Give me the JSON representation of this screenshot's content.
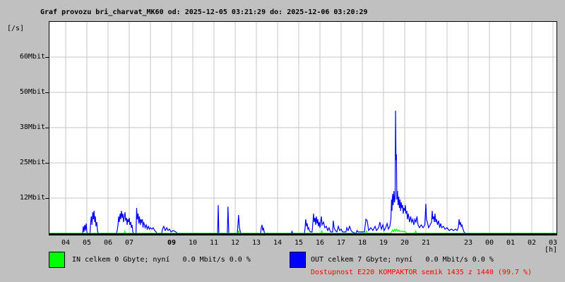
{
  "page": {
    "background": "#c0c0c0",
    "plot_background": "#ffffff",
    "grid_color": "#c6c6c6"
  },
  "title": "Graf provozu bri_charvat_MK60 od: 2025-12-05 03:21:29 do: 2025-12-06 03:20:29",
  "axes": {
    "y_unit": "[/s]",
    "x_unit": "[h]",
    "y_ticks": [
      {
        "label": "60Mbit",
        "value": 62.5
      },
      {
        "label": "50Mbit",
        "value": 50
      },
      {
        "label": "38Mbit",
        "value": 37.5
      },
      {
        "label": "25Mbit",
        "value": 25
      },
      {
        "label": "12Mbit",
        "value": 12.5
      }
    ],
    "x_ticks": [
      {
        "label": "04",
        "hour": 4
      },
      {
        "label": "05",
        "hour": 5
      },
      {
        "label": "06",
        "hour": 6
      },
      {
        "label": "07",
        "hour": 7
      },
      {
        "label": "09",
        "hour": 9,
        "bold": true
      },
      {
        "label": "10",
        "hour": 10
      },
      {
        "label": "11",
        "hour": 11
      },
      {
        "label": "12",
        "hour": 12
      },
      {
        "label": "13",
        "hour": 13
      },
      {
        "label": "14",
        "hour": 14
      },
      {
        "label": "15",
        "hour": 15
      },
      {
        "label": "16",
        "hour": 16
      },
      {
        "label": "17",
        "hour": 17
      },
      {
        "label": "18",
        "hour": 18
      },
      {
        "label": "19",
        "hour": 19
      },
      {
        "label": "20",
        "hour": 20
      },
      {
        "label": "21",
        "hour": 21
      },
      {
        "label": "23",
        "hour": 23
      },
      {
        "label": "00",
        "hour": 24
      },
      {
        "label": "01",
        "hour": 25
      },
      {
        "label": "02",
        "hour": 26
      },
      {
        "label": "03",
        "hour": 27
      }
    ]
  },
  "chart_data": {
    "type": "line",
    "title": "Graf provozu bri_charvat_MK60 od: 2025-12-05 03:21:29 do: 2025-12-06 03:20:29",
    "xlabel": "[h]",
    "ylabel": "[/s]",
    "x_range_hours": [
      3.23,
      27.33
    ],
    "ylim_mbit": [
      0,
      75
    ],
    "grid": true,
    "series": [
      {
        "name": "OUT",
        "color": "#0000ff",
        "points": [
          [
            3.23,
            0
          ],
          [
            4.8,
            0
          ],
          [
            4.83,
            2.5
          ],
          [
            4.86,
            0.5
          ],
          [
            4.9,
            3
          ],
          [
            4.93,
            1
          ],
          [
            4.97,
            3.5
          ],
          [
            5.0,
            0.5
          ],
          [
            5.03,
            0
          ],
          [
            5.15,
            0
          ],
          [
            5.18,
            4
          ],
          [
            5.21,
            6
          ],
          [
            5.24,
            3
          ],
          [
            5.28,
            7.5
          ],
          [
            5.31,
            5
          ],
          [
            5.34,
            8
          ],
          [
            5.37,
            4
          ],
          [
            5.4,
            6
          ],
          [
            5.43,
            2.5
          ],
          [
            5.47,
            4
          ],
          [
            5.5,
            1
          ],
          [
            5.53,
            0
          ],
          [
            6.4,
            0
          ],
          [
            6.43,
            1
          ],
          [
            6.47,
            3
          ],
          [
            6.5,
            6
          ],
          [
            6.53,
            4
          ],
          [
            6.57,
            7
          ],
          [
            6.6,
            5
          ],
          [
            6.63,
            8
          ],
          [
            6.67,
            5.5
          ],
          [
            6.7,
            7
          ],
          [
            6.73,
            4
          ],
          [
            6.77,
            6
          ],
          [
            6.8,
            7.5
          ],
          [
            6.83,
            4.5
          ],
          [
            6.87,
            5.5
          ],
          [
            6.9,
            3
          ],
          [
            6.93,
            5
          ],
          [
            6.97,
            4
          ],
          [
            7.0,
            5.5
          ],
          [
            7.03,
            3
          ],
          [
            7.07,
            4
          ],
          [
            7.1,
            2
          ],
          [
            7.13,
            3
          ],
          [
            7.17,
            0.5
          ],
          [
            7.2,
            0
          ],
          [
            7.32,
            0
          ],
          [
            7.35,
            9
          ],
          [
            7.38,
            5
          ],
          [
            7.42,
            7
          ],
          [
            7.45,
            3.5
          ],
          [
            7.48,
            6
          ],
          [
            7.52,
            3
          ],
          [
            7.55,
            5
          ],
          [
            7.58,
            4
          ],
          [
            7.62,
            5
          ],
          [
            7.65,
            2
          ],
          [
            7.68,
            4
          ],
          [
            7.72,
            3
          ],
          [
            7.75,
            2
          ],
          [
            7.8,
            3
          ],
          [
            7.85,
            1.5
          ],
          [
            7.9,
            2.5
          ],
          [
            7.95,
            1.5
          ],
          [
            8.0,
            2
          ],
          [
            8.07,
            1.5
          ],
          [
            8.13,
            2
          ],
          [
            8.2,
            1
          ],
          [
            8.27,
            0.5
          ],
          [
            8.3,
            0
          ],
          [
            8.53,
            0
          ],
          [
            8.57,
            1.5
          ],
          [
            8.63,
            2.5
          ],
          [
            8.7,
            1
          ],
          [
            8.77,
            2
          ],
          [
            8.83,
            1
          ],
          [
            8.9,
            1.5
          ],
          [
            8.97,
            0.5
          ],
          [
            9.07,
            1
          ],
          [
            9.2,
            0.5
          ],
          [
            9.27,
            0
          ],
          [
            11.17,
            0
          ],
          [
            11.2,
            10
          ],
          [
            11.23,
            0
          ],
          [
            11.63,
            0
          ],
          [
            11.66,
            9.5
          ],
          [
            11.7,
            0
          ],
          [
            12.1,
            0
          ],
          [
            12.13,
            3
          ],
          [
            12.16,
            6.5
          ],
          [
            12.2,
            2
          ],
          [
            12.23,
            1
          ],
          [
            12.27,
            0
          ],
          [
            13.2,
            0
          ],
          [
            13.23,
            2
          ],
          [
            13.27,
            3
          ],
          [
            13.3,
            1
          ],
          [
            13.33,
            2
          ],
          [
            13.37,
            0.5
          ],
          [
            13.4,
            0
          ],
          [
            14.65,
            0
          ],
          [
            14.68,
            0.7
          ],
          [
            14.72,
            0
          ],
          [
            15.27,
            0
          ],
          [
            15.3,
            2
          ],
          [
            15.33,
            5
          ],
          [
            15.37,
            2.5
          ],
          [
            15.4,
            3.5
          ],
          [
            15.43,
            1.5
          ],
          [
            15.47,
            2
          ],
          [
            15.5,
            1
          ],
          [
            15.55,
            0.5
          ],
          [
            15.63,
            0.5
          ],
          [
            15.67,
            4
          ],
          [
            15.7,
            7
          ],
          [
            15.73,
            4
          ],
          [
            15.77,
            5.5
          ],
          [
            15.8,
            3
          ],
          [
            15.83,
            6
          ],
          [
            15.87,
            3.5
          ],
          [
            15.9,
            5
          ],
          [
            15.93,
            2.5
          ],
          [
            15.97,
            4
          ],
          [
            16.0,
            2
          ],
          [
            16.07,
            6
          ],
          [
            16.1,
            3
          ],
          [
            16.17,
            4
          ],
          [
            16.23,
            2
          ],
          [
            16.3,
            2.5
          ],
          [
            16.37,
            1
          ],
          [
            16.43,
            2
          ],
          [
            16.5,
            0.5
          ],
          [
            16.6,
            0.5
          ],
          [
            16.63,
            4.5
          ],
          [
            16.67,
            2
          ],
          [
            16.73,
            1
          ],
          [
            16.8,
            0.5
          ],
          [
            16.87,
            2.5
          ],
          [
            16.93,
            1
          ],
          [
            17.0,
            1.5
          ],
          [
            17.07,
            0.5
          ],
          [
            17.23,
            0.5
          ],
          [
            17.27,
            2
          ],
          [
            17.33,
            1
          ],
          [
            17.4,
            2.5
          ],
          [
            17.47,
            1
          ],
          [
            17.53,
            0.5
          ],
          [
            17.7,
            0
          ],
          [
            17.75,
            1
          ],
          [
            17.8,
            0.5
          ],
          [
            18.1,
            0.5
          ],
          [
            18.17,
            5
          ],
          [
            18.23,
            4.5
          ],
          [
            18.3,
            1
          ],
          [
            18.4,
            2
          ],
          [
            18.5,
            1
          ],
          [
            18.6,
            2.5
          ],
          [
            18.67,
            1
          ],
          [
            18.77,
            2
          ],
          [
            18.83,
            4
          ],
          [
            18.9,
            1.5
          ],
          [
            18.97,
            3
          ],
          [
            19.03,
            1
          ],
          [
            19.1,
            2
          ],
          [
            19.17,
            3.5
          ],
          [
            19.23,
            1.5
          ],
          [
            19.3,
            2.5
          ],
          [
            19.35,
            5
          ],
          [
            19.38,
            12
          ],
          [
            19.4,
            8
          ],
          [
            19.43,
            14
          ],
          [
            19.46,
            10
          ],
          [
            19.49,
            15
          ],
          [
            19.52,
            11
          ],
          [
            19.55,
            13
          ],
          [
            19.57,
            43.5
          ],
          [
            19.59,
            26
          ],
          [
            19.61,
            28
          ],
          [
            19.63,
            12
          ],
          [
            19.66,
            15
          ],
          [
            19.69,
            10
          ],
          [
            19.72,
            13
          ],
          [
            19.75,
            9
          ],
          [
            19.78,
            12
          ],
          [
            19.81,
            8
          ],
          [
            19.84,
            11
          ],
          [
            19.87,
            9
          ],
          [
            19.9,
            10
          ],
          [
            19.93,
            7
          ],
          [
            19.96,
            9
          ],
          [
            20.0,
            8
          ],
          [
            20.03,
            10
          ],
          [
            20.06,
            7
          ],
          [
            20.1,
            8
          ],
          [
            20.13,
            5
          ],
          [
            20.17,
            7
          ],
          [
            20.23,
            4
          ],
          [
            20.28,
            6
          ],
          [
            20.33,
            4
          ],
          [
            20.38,
            5
          ],
          [
            20.43,
            3
          ],
          [
            20.48,
            5
          ],
          [
            20.53,
            4
          ],
          [
            20.58,
            6
          ],
          [
            20.63,
            3
          ],
          [
            20.7,
            2
          ],
          [
            20.78,
            3
          ],
          [
            20.87,
            2
          ],
          [
            20.95,
            3
          ],
          [
            21.0,
            10.5
          ],
          [
            21.03,
            5
          ],
          [
            21.07,
            4
          ],
          [
            21.13,
            2
          ],
          [
            21.2,
            3
          ],
          [
            21.27,
            4
          ],
          [
            21.3,
            8
          ],
          [
            21.33,
            5
          ],
          [
            21.37,
            6
          ],
          [
            21.4,
            4
          ],
          [
            21.43,
            7
          ],
          [
            21.47,
            4
          ],
          [
            21.5,
            5
          ],
          [
            21.55,
            3
          ],
          [
            21.6,
            4.5
          ],
          [
            21.65,
            2
          ],
          [
            21.7,
            3.5
          ],
          [
            21.75,
            2
          ],
          [
            21.83,
            2.5
          ],
          [
            21.9,
            1.5
          ],
          [
            22.0,
            2
          ],
          [
            22.1,
            1
          ],
          [
            22.2,
            1.5
          ],
          [
            22.3,
            1
          ],
          [
            22.4,
            1.5
          ],
          [
            22.47,
            1
          ],
          [
            22.53,
            2
          ],
          [
            22.57,
            5
          ],
          [
            22.6,
            3
          ],
          [
            22.63,
            4
          ],
          [
            22.67,
            2.5
          ],
          [
            22.7,
            3
          ],
          [
            22.75,
            1.5
          ],
          [
            22.8,
            0.5
          ],
          [
            22.87,
            0
          ],
          [
            27.3,
            0
          ]
        ]
      },
      {
        "name": "IN",
        "color": "#00ff00",
        "points": [
          [
            3.23,
            0
          ],
          [
            6.76,
            0
          ],
          [
            6.79,
            0.8
          ],
          [
            6.82,
            0
          ],
          [
            12.14,
            0
          ],
          [
            12.17,
            1
          ],
          [
            12.2,
            0
          ],
          [
            16.06,
            0
          ],
          [
            16.09,
            1
          ],
          [
            16.12,
            0
          ],
          [
            18.15,
            0
          ],
          [
            18.2,
            0.8
          ],
          [
            18.25,
            0
          ],
          [
            19.35,
            0
          ],
          [
            19.38,
            0.5
          ],
          [
            19.43,
            1.2
          ],
          [
            19.48,
            0.6
          ],
          [
            19.53,
            1.5
          ],
          [
            19.58,
            0.8
          ],
          [
            19.63,
            1.5
          ],
          [
            19.68,
            0.7
          ],
          [
            19.73,
            1.2
          ],
          [
            19.78,
            0.5
          ],
          [
            19.85,
            0.9
          ],
          [
            19.93,
            0.5
          ],
          [
            20.0,
            0.8
          ],
          [
            20.05,
            0.3
          ],
          [
            20.1,
            0
          ],
          [
            20.48,
            0
          ],
          [
            20.52,
            0.8
          ],
          [
            20.56,
            0
          ],
          [
            27.3,
            0
          ]
        ]
      }
    ]
  },
  "legend": {
    "in": {
      "color": "#00ff00",
      "label": "IN celkem 0 Gbyte; nyní   0.0 Mbit/s 0.0 %"
    },
    "out": {
      "color": "#0000ff",
      "label": "OUT celkem 7 Gbyte; nyní   0.0 Mbit/s 0.0 %"
    }
  },
  "availability": {
    "text": "Dostupnost E220 KOMPAKTOR semik 1435 z 1440 (99.7 %)",
    "color": "#ff0000"
  }
}
